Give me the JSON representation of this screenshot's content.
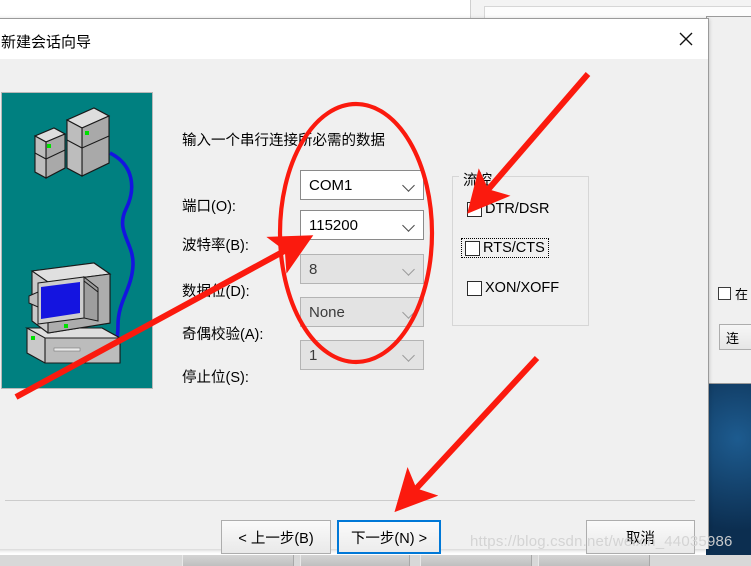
{
  "dialog": {
    "title": "新建会话向导",
    "close_icon": "close-icon",
    "instruction": "输入一个串行连接所必需的数据",
    "fields": [
      {
        "label": "端口(O):",
        "value": "COM1",
        "disabled": false
      },
      {
        "label": "波特率(B):",
        "value": "115200",
        "disabled": false
      },
      {
        "label": "数据位(D):",
        "value": "8",
        "disabled": true
      },
      {
        "label": "奇偶校验(A):",
        "value": "None",
        "disabled": true
      },
      {
        "label": "停止位(S):",
        "value": "1",
        "disabled": true
      }
    ],
    "flow_control": {
      "legend": "流控",
      "options": [
        {
          "label": "DTR/DSR",
          "checked": false,
          "focused": false
        },
        {
          "label": "RTS/CTS",
          "checked": false,
          "focused": true
        },
        {
          "label": "XON/XOFF",
          "checked": false,
          "focused": false
        }
      ]
    },
    "buttons": {
      "back": "< 上一步(B)",
      "next": "下一步(N) >",
      "cancel": "取消"
    }
  },
  "background": {
    "checkbox_label": "在",
    "button_label": "连"
  },
  "watermark": "https://blog.csdn.net/weixin_44035986",
  "colors": {
    "illustration_bg": "#008080",
    "dialog_bg": "#f0f0f0",
    "focus_blue": "#0078d7",
    "annotation_red": "#fb1a0e"
  }
}
